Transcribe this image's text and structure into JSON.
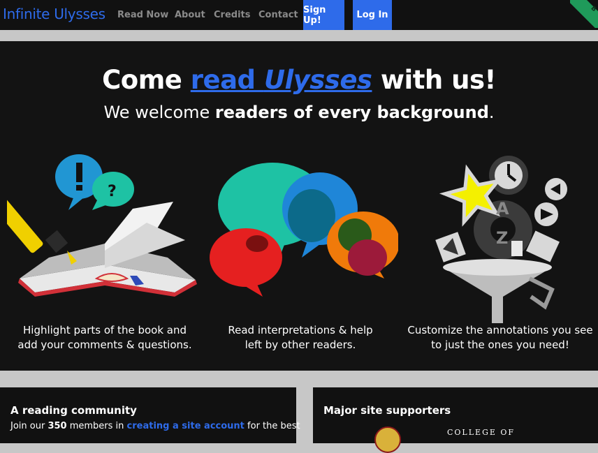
{
  "nav": {
    "brand": "Infinite Ulysses",
    "links": [
      "Read Now",
      "About",
      "Credits",
      "Contact"
    ],
    "signup": "Sign Up!",
    "login": "Log In",
    "corner_label": "B"
  },
  "hero": {
    "headline_pre": "Come ",
    "headline_link1": "read ",
    "headline_link2": "Ulysses",
    "headline_post": " with us!",
    "sub_pre": "We welcome ",
    "sub_bold": "readers of every background",
    "sub_post": "."
  },
  "features": [
    {
      "icon": "book-highlighter-icon",
      "line1": "Highlight parts of the book and",
      "line2": "add your comments & questions."
    },
    {
      "icon": "speech-bubbles-icon",
      "line1": "Read interpretations & help",
      "line2": "left by other readers."
    },
    {
      "icon": "filter-funnel-icon",
      "line1": "Customize the annotations you see",
      "line2": "to just the ones you need!"
    }
  ],
  "community": {
    "title": "A reading community",
    "pre": "Join our ",
    "count": "350",
    "mid": " members in ",
    "link": "creating a site account",
    "post": " for the best"
  },
  "supporters": {
    "title": "Major site supporters",
    "college": "COLLEGE OF"
  },
  "colors": {
    "accent": "#2e6bea",
    "nav_bg": "#111111",
    "hero_bg": "#131313",
    "page_bg": "#c7c7c7"
  }
}
